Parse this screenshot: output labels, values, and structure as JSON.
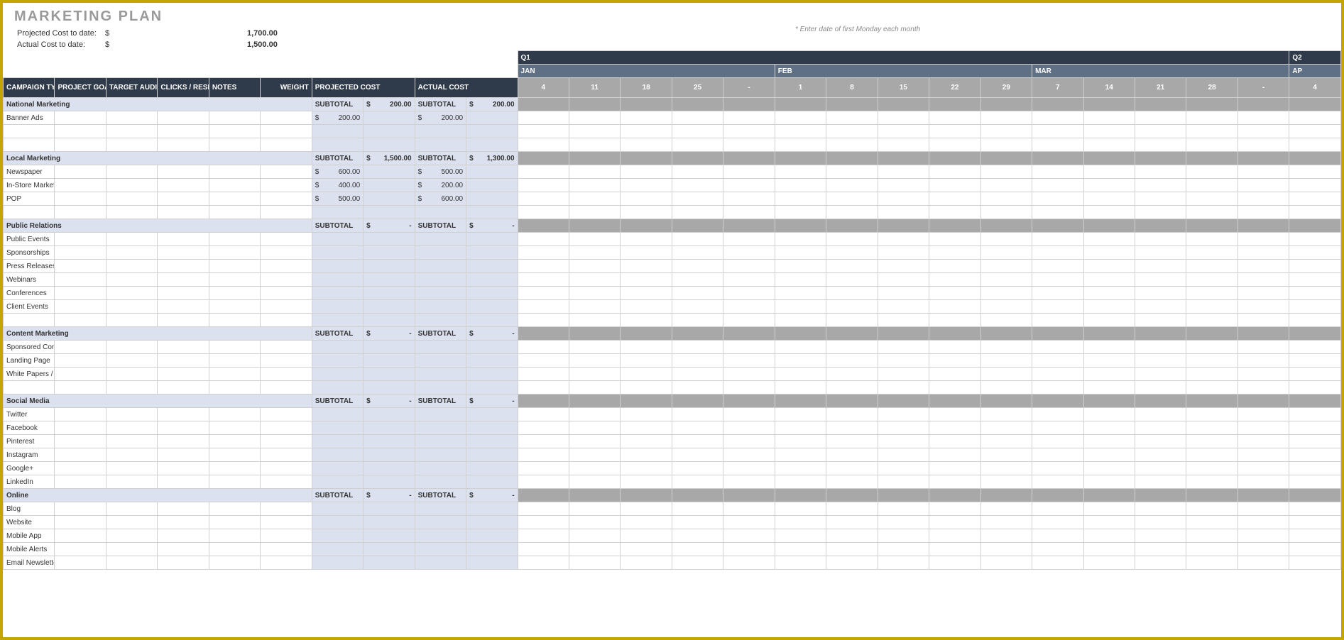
{
  "title": "MARKETING PLAN",
  "projected_label": "Projected Cost to date:",
  "actual_label": "Actual Cost to date:",
  "currency": "$",
  "projected_total": "1,700.00",
  "actual_total": "1,500.00",
  "hint": "* Enter date of first Monday each month",
  "q_label": "Q1",
  "q2_label": "Q2",
  "months": [
    "JAN",
    "FEB",
    "MAR",
    "AP"
  ],
  "days": [
    "4",
    "11",
    "18",
    "25",
    "-",
    "1",
    "8",
    "15",
    "22",
    "29",
    "7",
    "14",
    "21",
    "28",
    "-",
    "4"
  ],
  "cols": {
    "type": "CAMPAIGN TYPE",
    "goals": "PROJECT GOALS",
    "aud": "TARGET AUDIENCE",
    "clicks": "CLICKS / RESPONSE",
    "notes": "NOTES",
    "weight": "WEIGHT",
    "pcost": "PROJECTED COST",
    "acost": "ACTUAL COST",
    "subtotal": "SUBTOTAL"
  },
  "sections": [
    {
      "name": "National Marketing",
      "psub": "200.00",
      "asub": "200.00",
      "rows": [
        {
          "name": "Banner Ads",
          "p": "200.00",
          "a": "200.00"
        },
        {
          "name": ""
        },
        {
          "name": ""
        }
      ]
    },
    {
      "name": "Local Marketing",
      "psub": "1,500.00",
      "asub": "1,300.00",
      "rows": [
        {
          "name": "Newspaper",
          "p": "600.00",
          "a": "500.00"
        },
        {
          "name": "In-Store Marketing",
          "p": "400.00",
          "a": "200.00"
        },
        {
          "name": "POP",
          "p": "500.00",
          "a": "600.00"
        },
        {
          "name": ""
        }
      ]
    },
    {
      "name": "Public Relations",
      "psub": "-",
      "asub": "-",
      "rows": [
        {
          "name": "Public Events"
        },
        {
          "name": "Sponsorships"
        },
        {
          "name": "Press Releases"
        },
        {
          "name": "Webinars"
        },
        {
          "name": "Conferences"
        },
        {
          "name": "Client Events"
        },
        {
          "name": ""
        }
      ]
    },
    {
      "name": "Content Marketing",
      "psub": "-",
      "asub": "-",
      "rows": [
        {
          "name": "Sponsored Content"
        },
        {
          "name": "Landing Page"
        },
        {
          "name": "White Papers / ebooks"
        },
        {
          "name": ""
        }
      ]
    },
    {
      "name": "Social Media",
      "psub": "-",
      "asub": "-",
      "rows": [
        {
          "name": "Twitter"
        },
        {
          "name": "Facebook"
        },
        {
          "name": "Pinterest"
        },
        {
          "name": "Instagram"
        },
        {
          "name": "Google+"
        },
        {
          "name": "LinkedIn"
        }
      ]
    },
    {
      "name": "Online",
      "psub": "-",
      "asub": "-",
      "rows": [
        {
          "name": "Blog"
        },
        {
          "name": "Website"
        },
        {
          "name": "Mobile App"
        },
        {
          "name": "Mobile Alerts"
        },
        {
          "name": "Email Newsletter"
        }
      ]
    }
  ]
}
